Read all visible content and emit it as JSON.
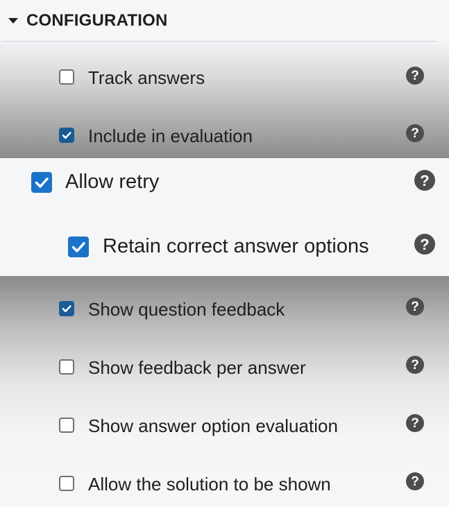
{
  "section": {
    "title": "CONFIGURATION",
    "caret_icon": "triangle-down-icon",
    "help_glyph": "?"
  },
  "options": [
    {
      "label": "Track answers",
      "checked": false
    },
    {
      "label": "Include in evaluation",
      "checked": true
    },
    {
      "label": "Allow retry",
      "checked": true
    },
    {
      "label": "Retain correct answer options",
      "checked": true
    },
    {
      "label": "Show question feedback",
      "checked": true
    },
    {
      "label": "Show feedback per answer",
      "checked": false
    },
    {
      "label": "Show answer option evaluation",
      "checked": false
    },
    {
      "label": "Allow the solution to be shown",
      "checked": false
    }
  ],
  "colors": {
    "checkbox_checked": "#1a5c95",
    "checkbox_checked_highlight": "#1a73c9",
    "help_icon": "#4d4d4d",
    "text": "#1f1f1f"
  }
}
